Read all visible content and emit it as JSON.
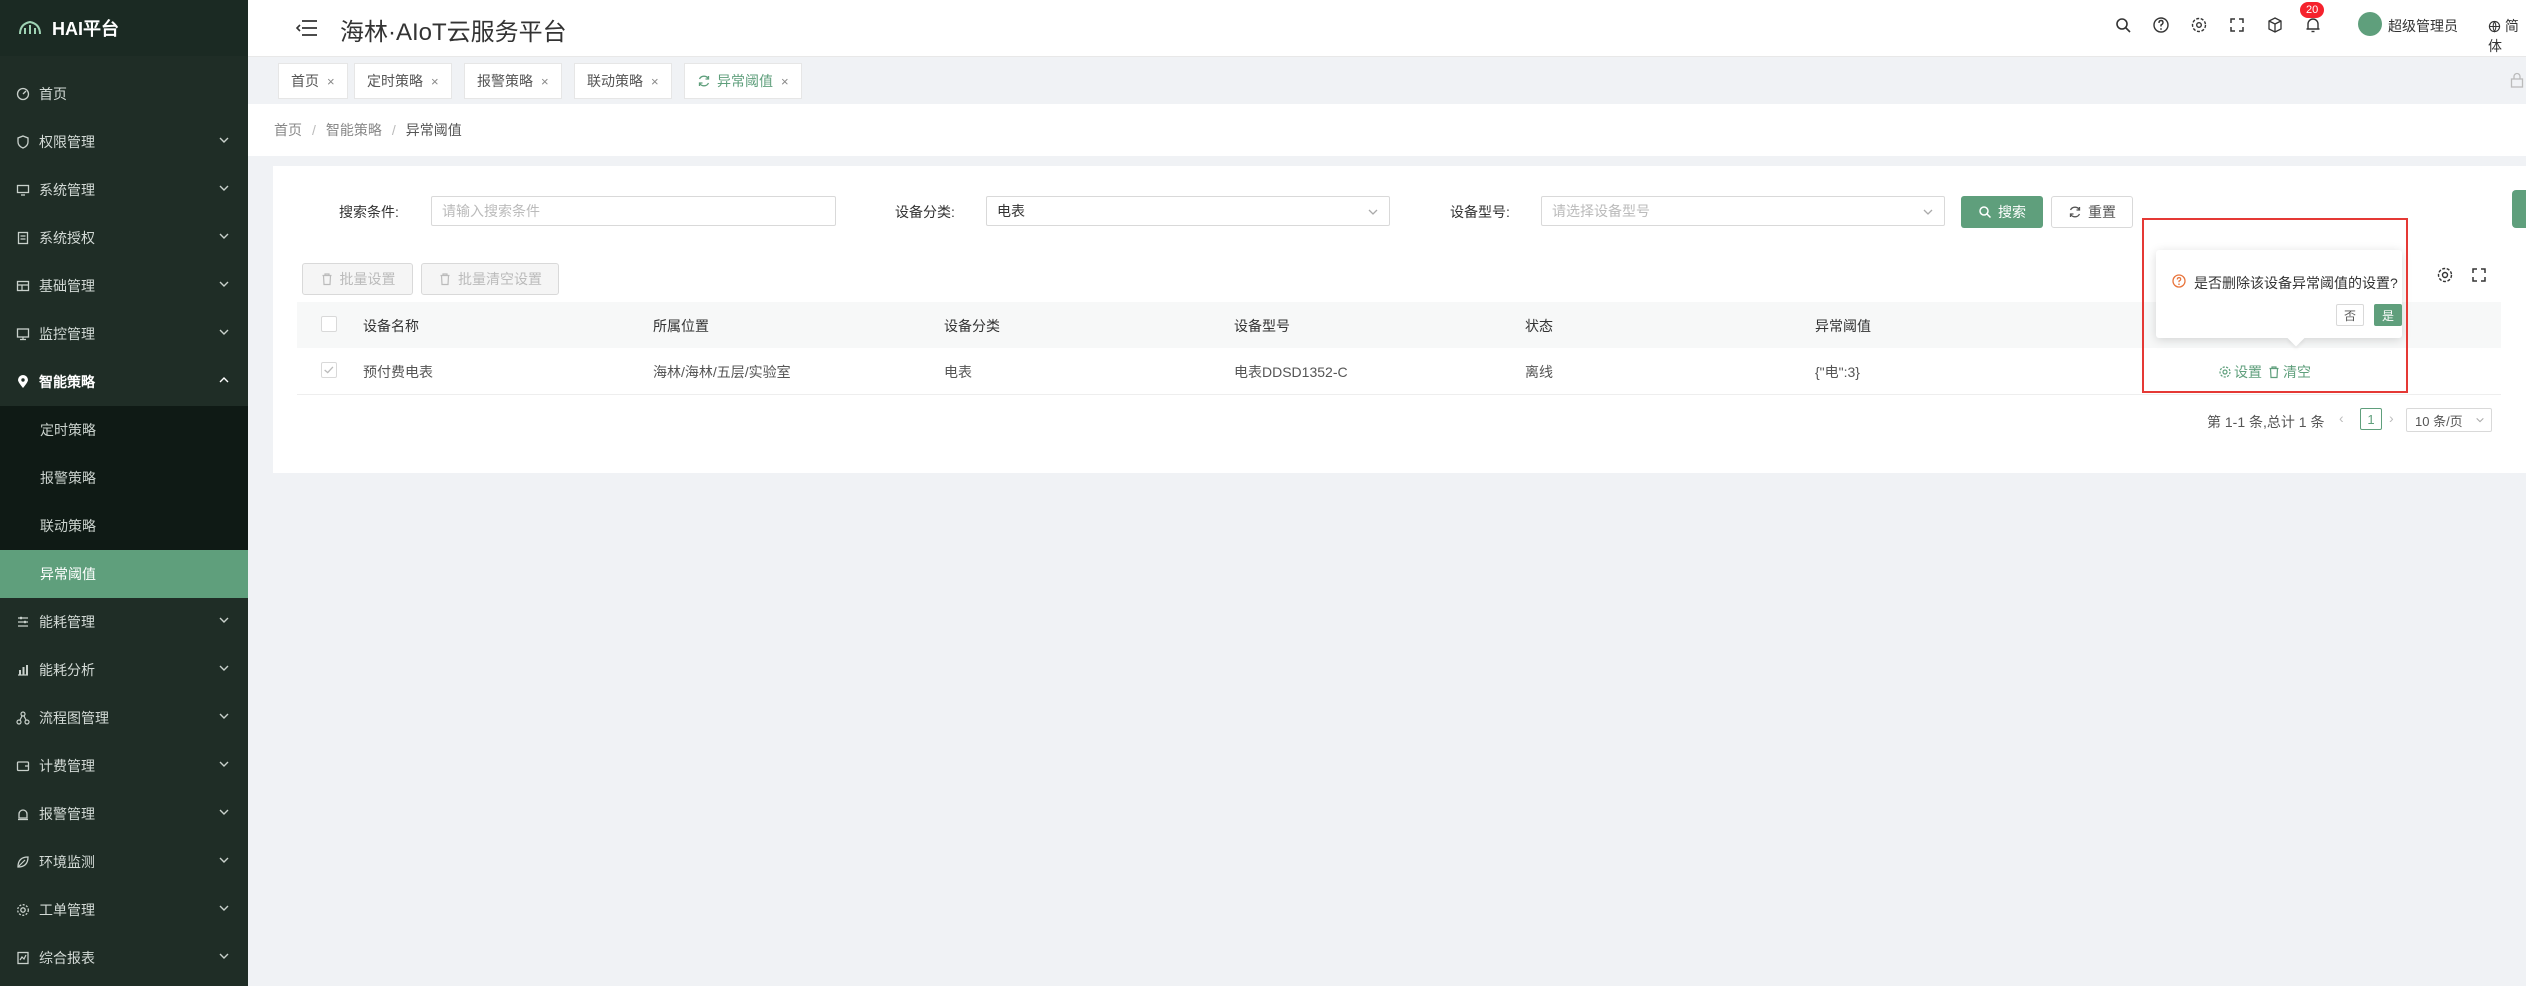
{
  "app": {
    "logo_text": "HAI平台",
    "title": "海林·AIoT云服务平台"
  },
  "sidebar": {
    "items": [
      {
        "label": "首页",
        "icon": "dashboard-icon",
        "has_children": false
      },
      {
        "label": "权限管理",
        "icon": "shield-icon",
        "has_children": true
      },
      {
        "label": "系统管理",
        "icon": "monitor-icon",
        "has_children": true
      },
      {
        "label": "系统授权",
        "icon": "document-icon",
        "has_children": true
      },
      {
        "label": "基础管理",
        "icon": "grid-icon",
        "has_children": true
      },
      {
        "label": "监控管理",
        "icon": "screen-icon",
        "has_children": true
      },
      {
        "label": "智能策略",
        "icon": "location-icon",
        "has_children": true,
        "expanded": true
      }
    ],
    "submenu": [
      {
        "label": "定时策略"
      },
      {
        "label": "报警策略"
      },
      {
        "label": "联动策略"
      },
      {
        "label": "异常阈值",
        "active": true
      }
    ],
    "items_after": [
      {
        "label": "能耗管理",
        "icon": "sliders-icon"
      },
      {
        "label": "能耗分析",
        "icon": "bar-chart-icon"
      },
      {
        "label": "流程图管理",
        "icon": "flow-icon"
      },
      {
        "label": "计费管理",
        "icon": "wallet-icon"
      },
      {
        "label": "报警管理",
        "icon": "alarm-icon"
      },
      {
        "label": "环境监测",
        "icon": "leaf-icon"
      },
      {
        "label": "工单管理",
        "icon": "settings-icon"
      },
      {
        "label": "综合报表",
        "icon": "report-icon"
      }
    ]
  },
  "header": {
    "user_name": "超级管理员",
    "language": "简体",
    "notification_count": "20",
    "icons": [
      "search-icon",
      "help-icon",
      "theme-icon",
      "fullscreen-icon",
      "cube-icon",
      "bell-icon"
    ]
  },
  "tabs": [
    {
      "label": "首页",
      "active": false
    },
    {
      "label": "定时策略",
      "active": false
    },
    {
      "label": "报警策略",
      "active": false
    },
    {
      "label": "联动策略",
      "active": false
    },
    {
      "label": "异常阈值",
      "active": true
    }
  ],
  "breadcrumb": {
    "items": [
      "首页",
      "智能策略"
    ],
    "current": "异常阈值",
    "separator": "/"
  },
  "search": {
    "condition_label": "搜索条件:",
    "condition_placeholder": "请输入搜索条件",
    "category_label": "设备分类:",
    "category_value": "电表",
    "model_label": "设备型号:",
    "model_placeholder": "请选择设备型号",
    "search_button": "搜索",
    "reset_button": "重置"
  },
  "toolbar": {
    "batch_set": "批量设置",
    "batch_clear": "批量清空设置"
  },
  "table": {
    "columns": [
      "设备名称",
      "所属位置",
      "设备分类",
      "设备型号",
      "状态",
      "异常阈值"
    ],
    "rows": [
      {
        "name": "预付费电表",
        "location": "海林/海林/五层/实验室",
        "category": "电表",
        "model": "电表DDSD1352-C",
        "status": "离线",
        "threshold": "{\"电\":3}",
        "actions": {
          "set": "设置",
          "clear": "清空"
        },
        "checked": true
      }
    ]
  },
  "pagination": {
    "summary": "第 1-1 条,总计 1 条",
    "current_page": "1",
    "page_size": "10 条/页"
  },
  "popconfirm": {
    "message": "是否删除该设备异常阈值的设置?",
    "cancel": "否",
    "confirm": "是"
  },
  "colors": {
    "accent": "#5f9f7c",
    "sidebar_bg": "#1f2d26",
    "highlight": "#e53935"
  }
}
